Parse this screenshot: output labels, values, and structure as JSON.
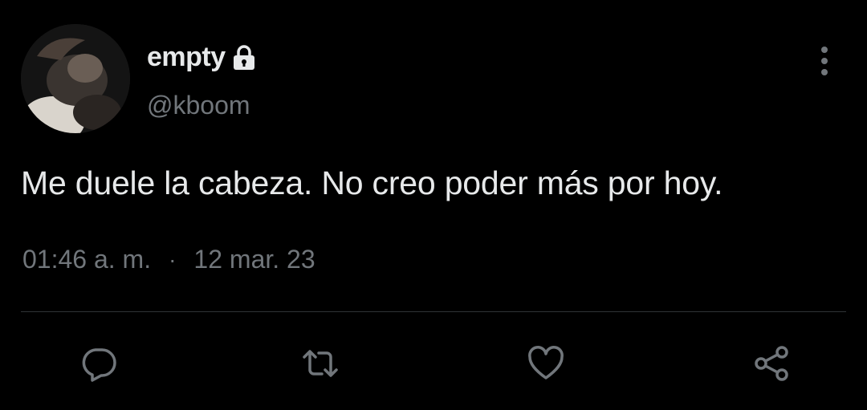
{
  "tweet": {
    "author": {
      "display_name": "empty",
      "handle": "@kboom",
      "protected": true
    },
    "text": "Me duele la cabeza. No creo poder más por hoy.",
    "time": "01:46 a. m.",
    "separator": "·",
    "date": "12 mar. 23"
  },
  "actions": [
    {
      "name": "reply",
      "icon": "reply-icon"
    },
    {
      "name": "retweet",
      "icon": "retweet-icon"
    },
    {
      "name": "like",
      "icon": "heart-icon"
    },
    {
      "name": "share",
      "icon": "share-icon"
    }
  ],
  "colors": {
    "background": "#000000",
    "primary_text": "#e7e9ea",
    "secondary_text": "#71767b",
    "divider": "#2f3336"
  }
}
